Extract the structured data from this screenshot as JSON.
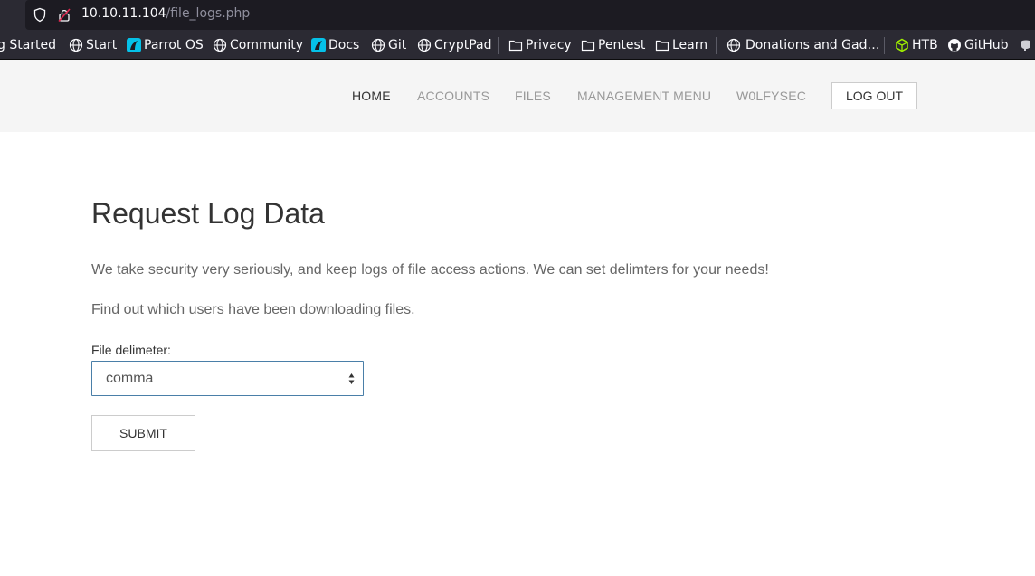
{
  "browser": {
    "url_host": "10.10.11.104",
    "url_path": "/file_logs.php"
  },
  "bookmarks": [
    {
      "label": "g Started",
      "icon": "none"
    },
    {
      "label": "Start",
      "icon": "globe-icon"
    },
    {
      "label": "Parrot OS",
      "icon": "parrot-icon"
    },
    {
      "label": "Community",
      "icon": "globe-icon"
    },
    {
      "label": "Docs",
      "icon": "parrot-icon"
    },
    {
      "label": "Git",
      "icon": "globe-icon"
    },
    {
      "label": "CryptPad",
      "icon": "globe-icon"
    },
    {
      "label": "Privacy",
      "icon": "folder-icon"
    },
    {
      "label": "Pentest",
      "icon": "folder-icon"
    },
    {
      "label": "Learn",
      "icon": "folder-icon"
    },
    {
      "label": "Donations and Gad…",
      "icon": "globe-icon"
    },
    {
      "label": "HTB",
      "icon": "htb-cube-icon"
    },
    {
      "label": "GitHub",
      "icon": "github-icon"
    }
  ],
  "nav": {
    "home": "HOME",
    "accounts": "ACCOUNTS",
    "files": "FILES",
    "management": "MANAGEMENT MENU",
    "user": "W0LFYSEC",
    "logout": "LOG OUT"
  },
  "main": {
    "title": "Request Log Data",
    "intro": "We take security very seriously, and keep logs of file access actions. We can set delimters for your needs!",
    "hint": "Find out which users have been downloading files.",
    "delimiter_label": "File delimeter:",
    "delimiter_value": "comma",
    "submit_label": "SUBMIT"
  },
  "colors": {
    "browser_chrome": "#2b2a33",
    "nav_background": "#f5f5f5",
    "select_focus_border": "#4a7fa8",
    "accent_cyan": "#00b4d8",
    "htb_green": "#9fef00"
  }
}
